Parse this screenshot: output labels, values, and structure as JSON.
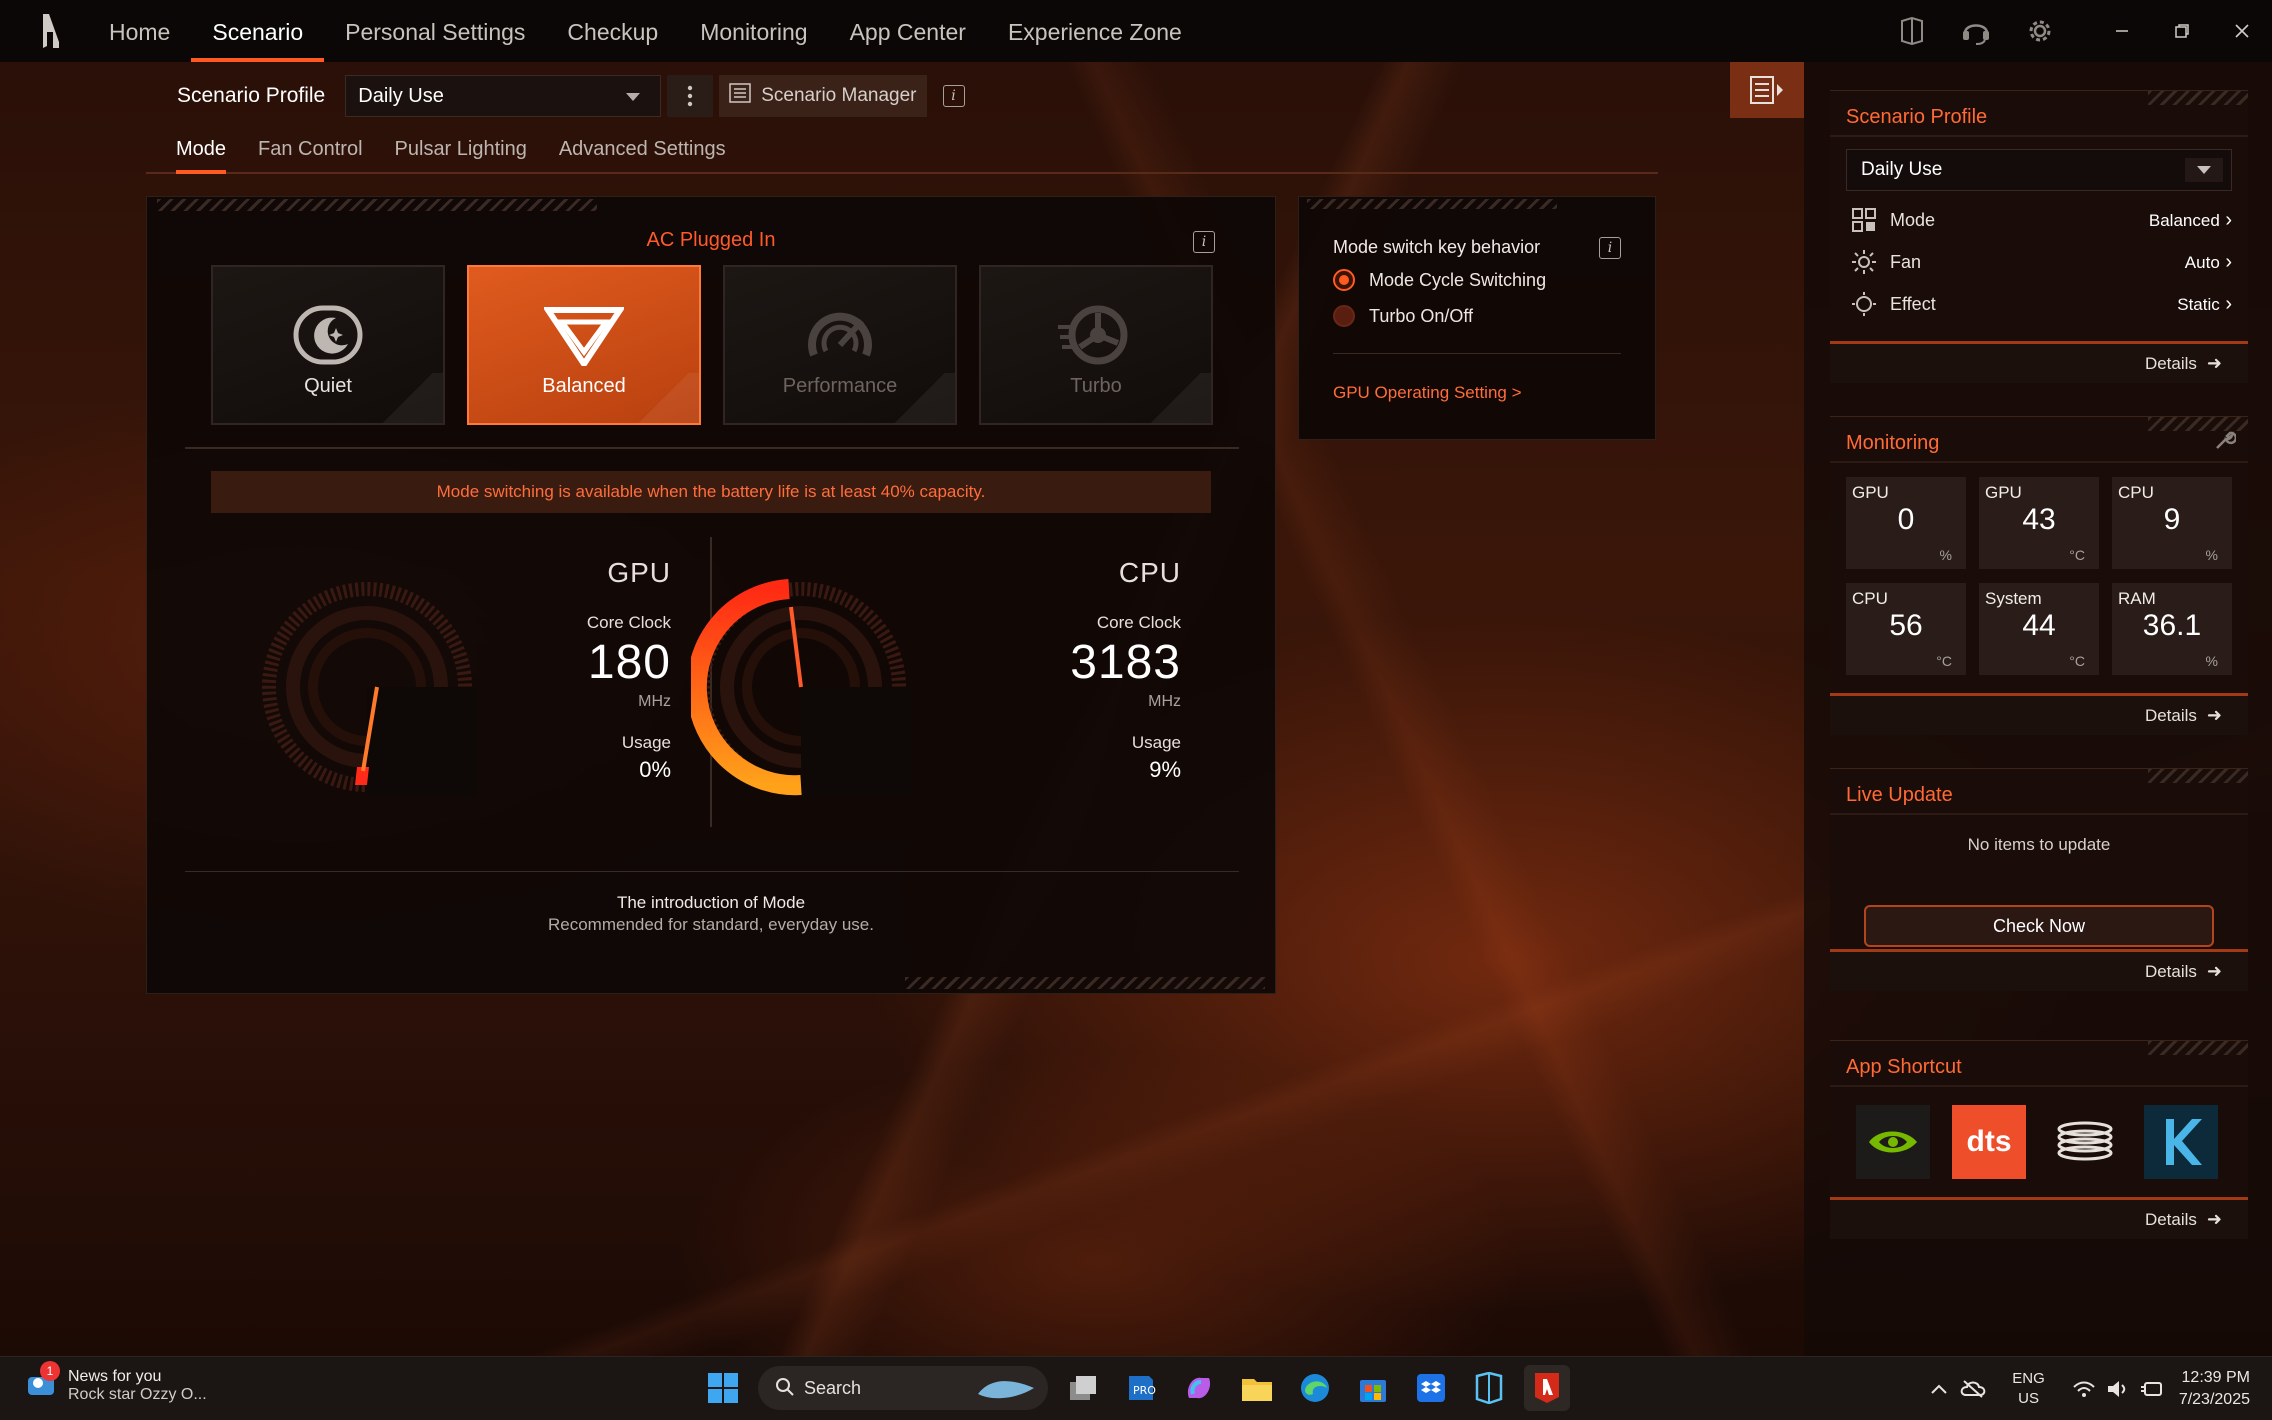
{
  "nav": {
    "items": [
      {
        "label": "Home",
        "active": false
      },
      {
        "label": "Scenario",
        "active": true
      },
      {
        "label": "Personal Settings",
        "active": false
      },
      {
        "label": "Checkup",
        "active": false
      },
      {
        "label": "Monitoring",
        "active": false
      },
      {
        "label": "App Center",
        "active": false
      },
      {
        "label": "Experience Zone",
        "active": false
      }
    ]
  },
  "scenario_bar": {
    "label": "Scenario Profile",
    "selected": "Daily Use",
    "manager_label": "Scenario Manager"
  },
  "subtabs": [
    "Mode",
    "Fan Control",
    "Pulsar Lighting",
    "Advanced Settings"
  ],
  "mode_panel": {
    "title": "AC Plugged In",
    "modes": [
      {
        "label": "Quiet",
        "state": "normal"
      },
      {
        "label": "Balanced",
        "state": "active"
      },
      {
        "label": "Performance",
        "state": "disabled"
      },
      {
        "label": "Turbo",
        "state": "disabled"
      }
    ],
    "warning": "Mode switching is available when the battery life is at least 40% capacity.",
    "gpu": {
      "title": "GPU",
      "clock_label": "Core Clock",
      "clock_value": "180",
      "clock_unit": "MHz",
      "usage_label": "Usage",
      "usage_value": "0%"
    },
    "cpu": {
      "title": "CPU",
      "clock_label": "Core Clock",
      "clock_value": "3183",
      "clock_unit": "MHz",
      "usage_label": "Usage",
      "usage_value": "9%"
    },
    "intro_title": "The introduction of Mode",
    "intro_desc": "Recommended for standard, everyday use."
  },
  "key_behavior": {
    "title": "Mode switch key behavior",
    "options": [
      {
        "label": "Mode Cycle Switching",
        "checked": true
      },
      {
        "label": "Turbo On/Off",
        "checked": false
      }
    ],
    "gpu_link": "GPU Operating Setting >"
  },
  "right_panel": {
    "scenario": {
      "title": "Scenario Profile",
      "selected": "Daily Use",
      "rows": [
        {
          "label": "Mode",
          "value": "Balanced",
          "icon": "mode-grid-icon"
        },
        {
          "label": "Fan",
          "value": "Auto",
          "icon": "fan-icon"
        },
        {
          "label": "Effect",
          "value": "Static",
          "icon": "effect-icon"
        }
      ],
      "details": "Details"
    },
    "monitoring": {
      "title": "Monitoring",
      "cells": [
        {
          "label": "GPU",
          "value": "0",
          "unit": "%"
        },
        {
          "label": "GPU",
          "value": "43",
          "unit": "°C"
        },
        {
          "label": "CPU",
          "value": "9",
          "unit": "%"
        },
        {
          "label": "CPU",
          "value": "56",
          "unit": "°C"
        },
        {
          "label": "System",
          "value": "44",
          "unit": "°C"
        },
        {
          "label": "RAM",
          "value": "36.1",
          "unit": "%"
        }
      ],
      "details": "Details"
    },
    "live_update": {
      "title": "Live Update",
      "message": "No items to update",
      "button": "Check Now",
      "details": "Details"
    },
    "app_shortcut": {
      "title": "App Shortcut",
      "apps": [
        "nvidia-app-icon",
        "dts-app-icon",
        "coil-app-icon",
        "k-app-icon"
      ],
      "dts_text": "dts",
      "details": "Details"
    }
  },
  "taskbar": {
    "news_title": "News for you",
    "news_sub": "Rock star Ozzy O...",
    "news_badge": "1",
    "search": "Search",
    "lang_1": "ENG",
    "lang_2": "US",
    "time": "12:39 PM",
    "date": "7/23/2025"
  },
  "colors": {
    "accent": "#ff5a1f",
    "panel": "#0e0806"
  }
}
